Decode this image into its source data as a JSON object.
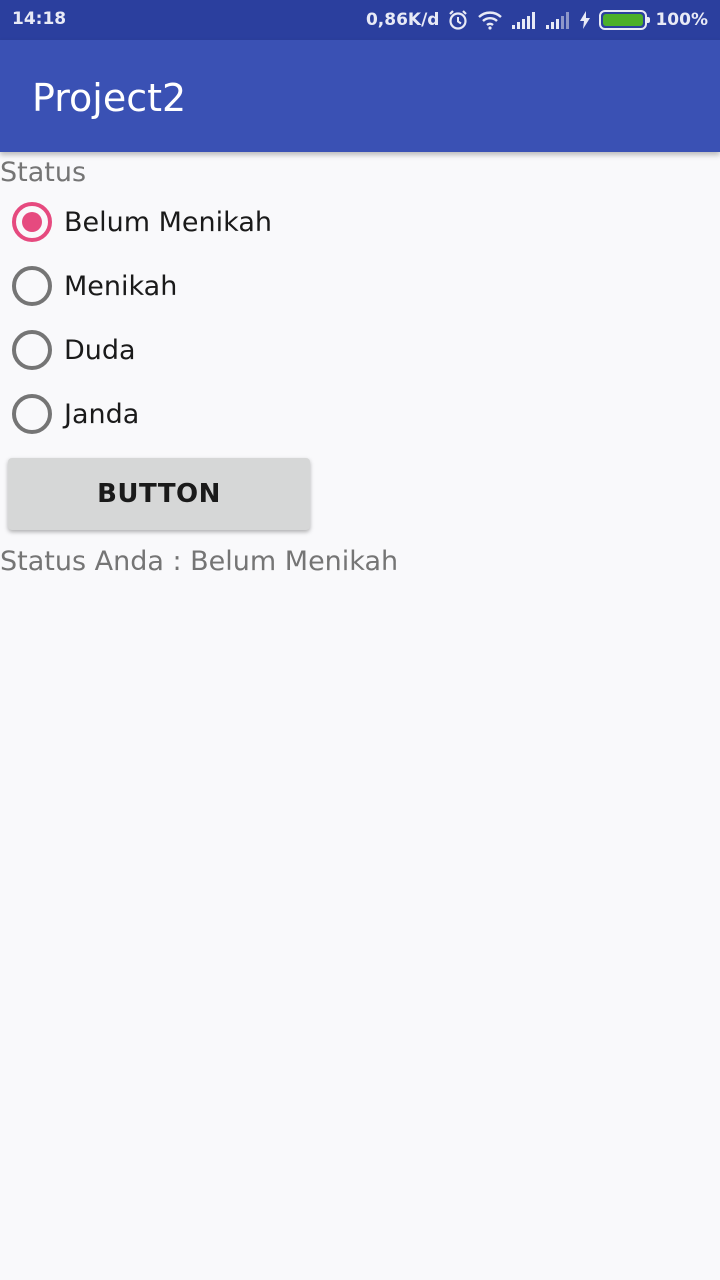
{
  "status_bar": {
    "time": "14:18",
    "speed": "0,86K/d",
    "battery_percent": "100%",
    "icons": [
      "alarm-icon",
      "wifi-icon",
      "signal-icon",
      "signal-icon-2",
      "charging-icon",
      "battery-icon"
    ],
    "battery_level": 1.0,
    "battery_color": "#4caf2a"
  },
  "app_bar": {
    "title": "Project2",
    "color": "#3a51b4"
  },
  "form": {
    "status_label": "Status",
    "options": [
      {
        "label": "Belum Menikah",
        "checked": true
      },
      {
        "label": "Menikah",
        "checked": false
      },
      {
        "label": "Duda",
        "checked": false
      },
      {
        "label": "Janda",
        "checked": false
      }
    ],
    "accent_color": "#e64a7f",
    "button_label": "BUTTON",
    "result_text": "Status Anda : Belum Menikah"
  }
}
